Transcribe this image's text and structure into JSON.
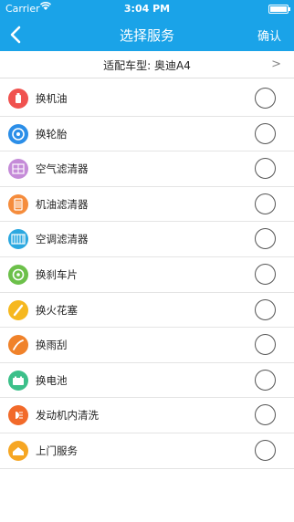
{
  "status_bar": {
    "carrier": "Carrier",
    "time": "3:04 PM"
  },
  "nav": {
    "title": "选择服务",
    "confirm_label": "确认"
  },
  "car_model": {
    "label": "适配车型:  奥迪A4",
    "chevron": ">"
  },
  "services": [
    {
      "name": "换机油",
      "icon": "oil-bottle-icon",
      "color": "#f0524f"
    },
    {
      "name": "换轮胎",
      "icon": "tire-icon",
      "color": "#2b8ee8"
    },
    {
      "name": "空气滤清器",
      "icon": "air-filter-icon",
      "color": "#c58bd8"
    },
    {
      "name": "机油滤清器",
      "icon": "oil-filter-icon",
      "color": "#f58c3c"
    },
    {
      "name": "空调滤清器",
      "icon": "ac-filter-icon",
      "color": "#2ba8e0"
    },
    {
      "name": "换刹车片",
      "icon": "brake-pad-icon",
      "color": "#6cc04a"
    },
    {
      "name": "换火花塞",
      "icon": "spark-plug-icon",
      "color": "#f6b81f"
    },
    {
      "name": "换雨刮",
      "icon": "wiper-icon",
      "color": "#f0822a"
    },
    {
      "name": "换电池",
      "icon": "battery-icon",
      "color": "#3cc08a"
    },
    {
      "name": "发动机内清洗",
      "icon": "engine-clean-icon",
      "color": "#f26a2a"
    },
    {
      "name": "上门服务",
      "icon": "home-service-icon",
      "color": "#f6a623"
    }
  ]
}
